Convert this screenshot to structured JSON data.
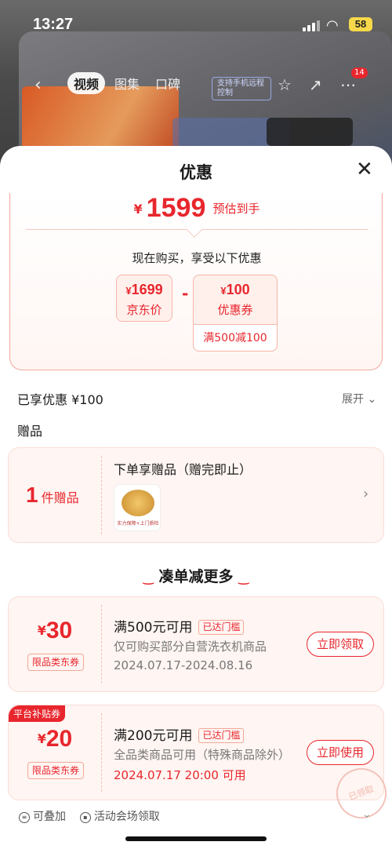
{
  "status_bar": {
    "time": "13:27",
    "battery": "58"
  },
  "product_header": {
    "tabs": [
      "视频",
      "图集",
      "口碑"
    ],
    "feature_pill": "支持手机远程控制",
    "cart_badge": "14"
  },
  "sheet": {
    "title": "优惠",
    "estimate": {
      "currency": "¥",
      "price": "1599",
      "label": "预估到手"
    },
    "buy_now_text": "现在购买，享受以下优惠",
    "jd_price": {
      "currency": "¥",
      "value": "1699",
      "label": "京东价"
    },
    "operator": "-",
    "coupon": {
      "currency": "¥",
      "value": "100",
      "label": "优惠券",
      "condition": "满500减100"
    },
    "enjoyed_text": "已享优惠 ¥100",
    "expand_label": "展开"
  },
  "gift": {
    "section_label": "赠品",
    "count": "1",
    "count_unit": "件赠品",
    "title": "下单享赠品（赠完即止）",
    "thumb_caption": "实力保障+上门质检"
  },
  "more_section": {
    "title": "凑单减更多"
  },
  "coupons": [
    {
      "amount": "30",
      "currency": "¥",
      "type": "限品类东券",
      "condition": "满500元可用",
      "reached": "已达门槛",
      "desc": "仅可购买部分自营洗衣机商品",
      "date": "2024.07.17-2024.08.16",
      "button": "立即领取"
    },
    {
      "amount": "20",
      "currency": "¥",
      "type": "限品类东券",
      "tag": "平台补贴券",
      "condition": "满200元可用",
      "reached": "已达门槛",
      "desc": "全品类商品可用（特殊商品除外）",
      "date": "2024.07.17 20:00 可用",
      "button": "立即使用",
      "stamp": "已领取"
    }
  ],
  "footer": {
    "stackable": "可叠加",
    "venue": "活动会场领取"
  },
  "colors": {
    "accent": "#e8262d",
    "card_bg": "#fff5f2"
  }
}
